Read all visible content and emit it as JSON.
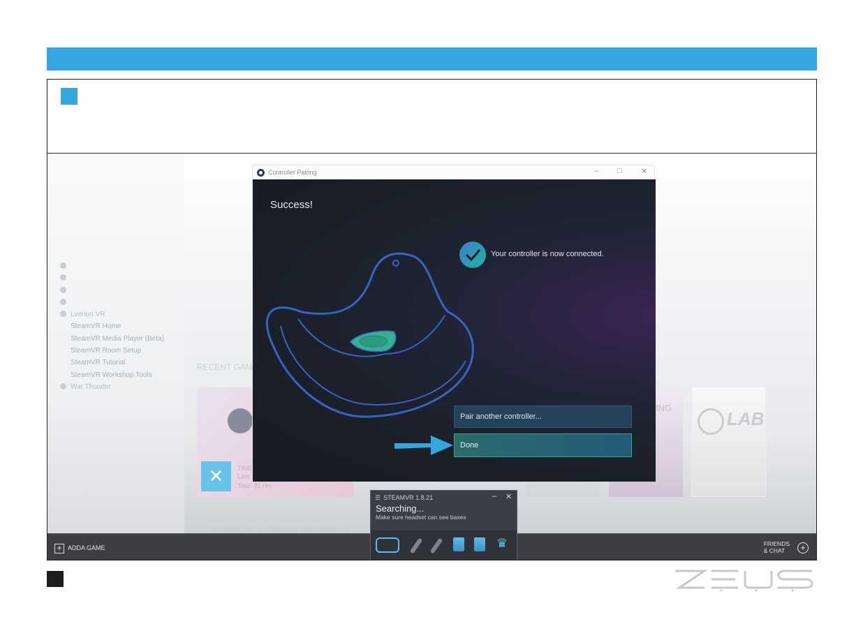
{
  "steam": {
    "sidebar_items": [
      {
        "label": "",
        "type": "dot"
      },
      {
        "label": "",
        "type": "dot"
      },
      {
        "label": "",
        "type": "dot"
      },
      {
        "label": "",
        "type": "dot"
      },
      {
        "label": "Lverion VR",
        "type": "dot"
      },
      {
        "label": "SteamVR Home",
        "type": "sub"
      },
      {
        "label": "SteamVR Media Player (Beta)",
        "type": "sub"
      },
      {
        "label": "SteamVR Room Setup",
        "type": "sub"
      },
      {
        "label": "SteamVR Tutorial",
        "type": "sub"
      },
      {
        "label": "SteamVR Workshop Tools",
        "type": "sub"
      },
      {
        "label": "War Thunder",
        "type": "dot"
      }
    ],
    "recent_games_label": "RECENT GAM",
    "tile_time_label": "TIME",
    "tile_last_label": "Last",
    "tile_total": "Total: 81 hrs",
    "tile_ting": "TING",
    "tile_lab": "LAB",
    "all_games": "ALL GAMES (11) ∨    SORT BY  Alphabetical ∨",
    "add_game": "ADDA GAME",
    "friends_line1": "FRIENDS",
    "friends_line2": "& CHAT"
  },
  "dialog": {
    "title": "Controller Pairing",
    "minimize": "–",
    "maximize": "□",
    "close": "✕",
    "heading": "Success!",
    "status": "Your controller is now connected.",
    "pair_button": "Pair another controller...",
    "done_button": "Done"
  },
  "steamvr": {
    "title": "STEAMVR 1.8.21",
    "menu_glyph": "☰",
    "minimize": "–",
    "close": "✕",
    "status": "Searching...",
    "hint": "Make sure headset can see bases"
  },
  "colors": {
    "accent_blue": "#35a7e0",
    "done_border": "#3aa391",
    "controller_outline": "#3a62c4",
    "trackpad": "#35b28c"
  }
}
